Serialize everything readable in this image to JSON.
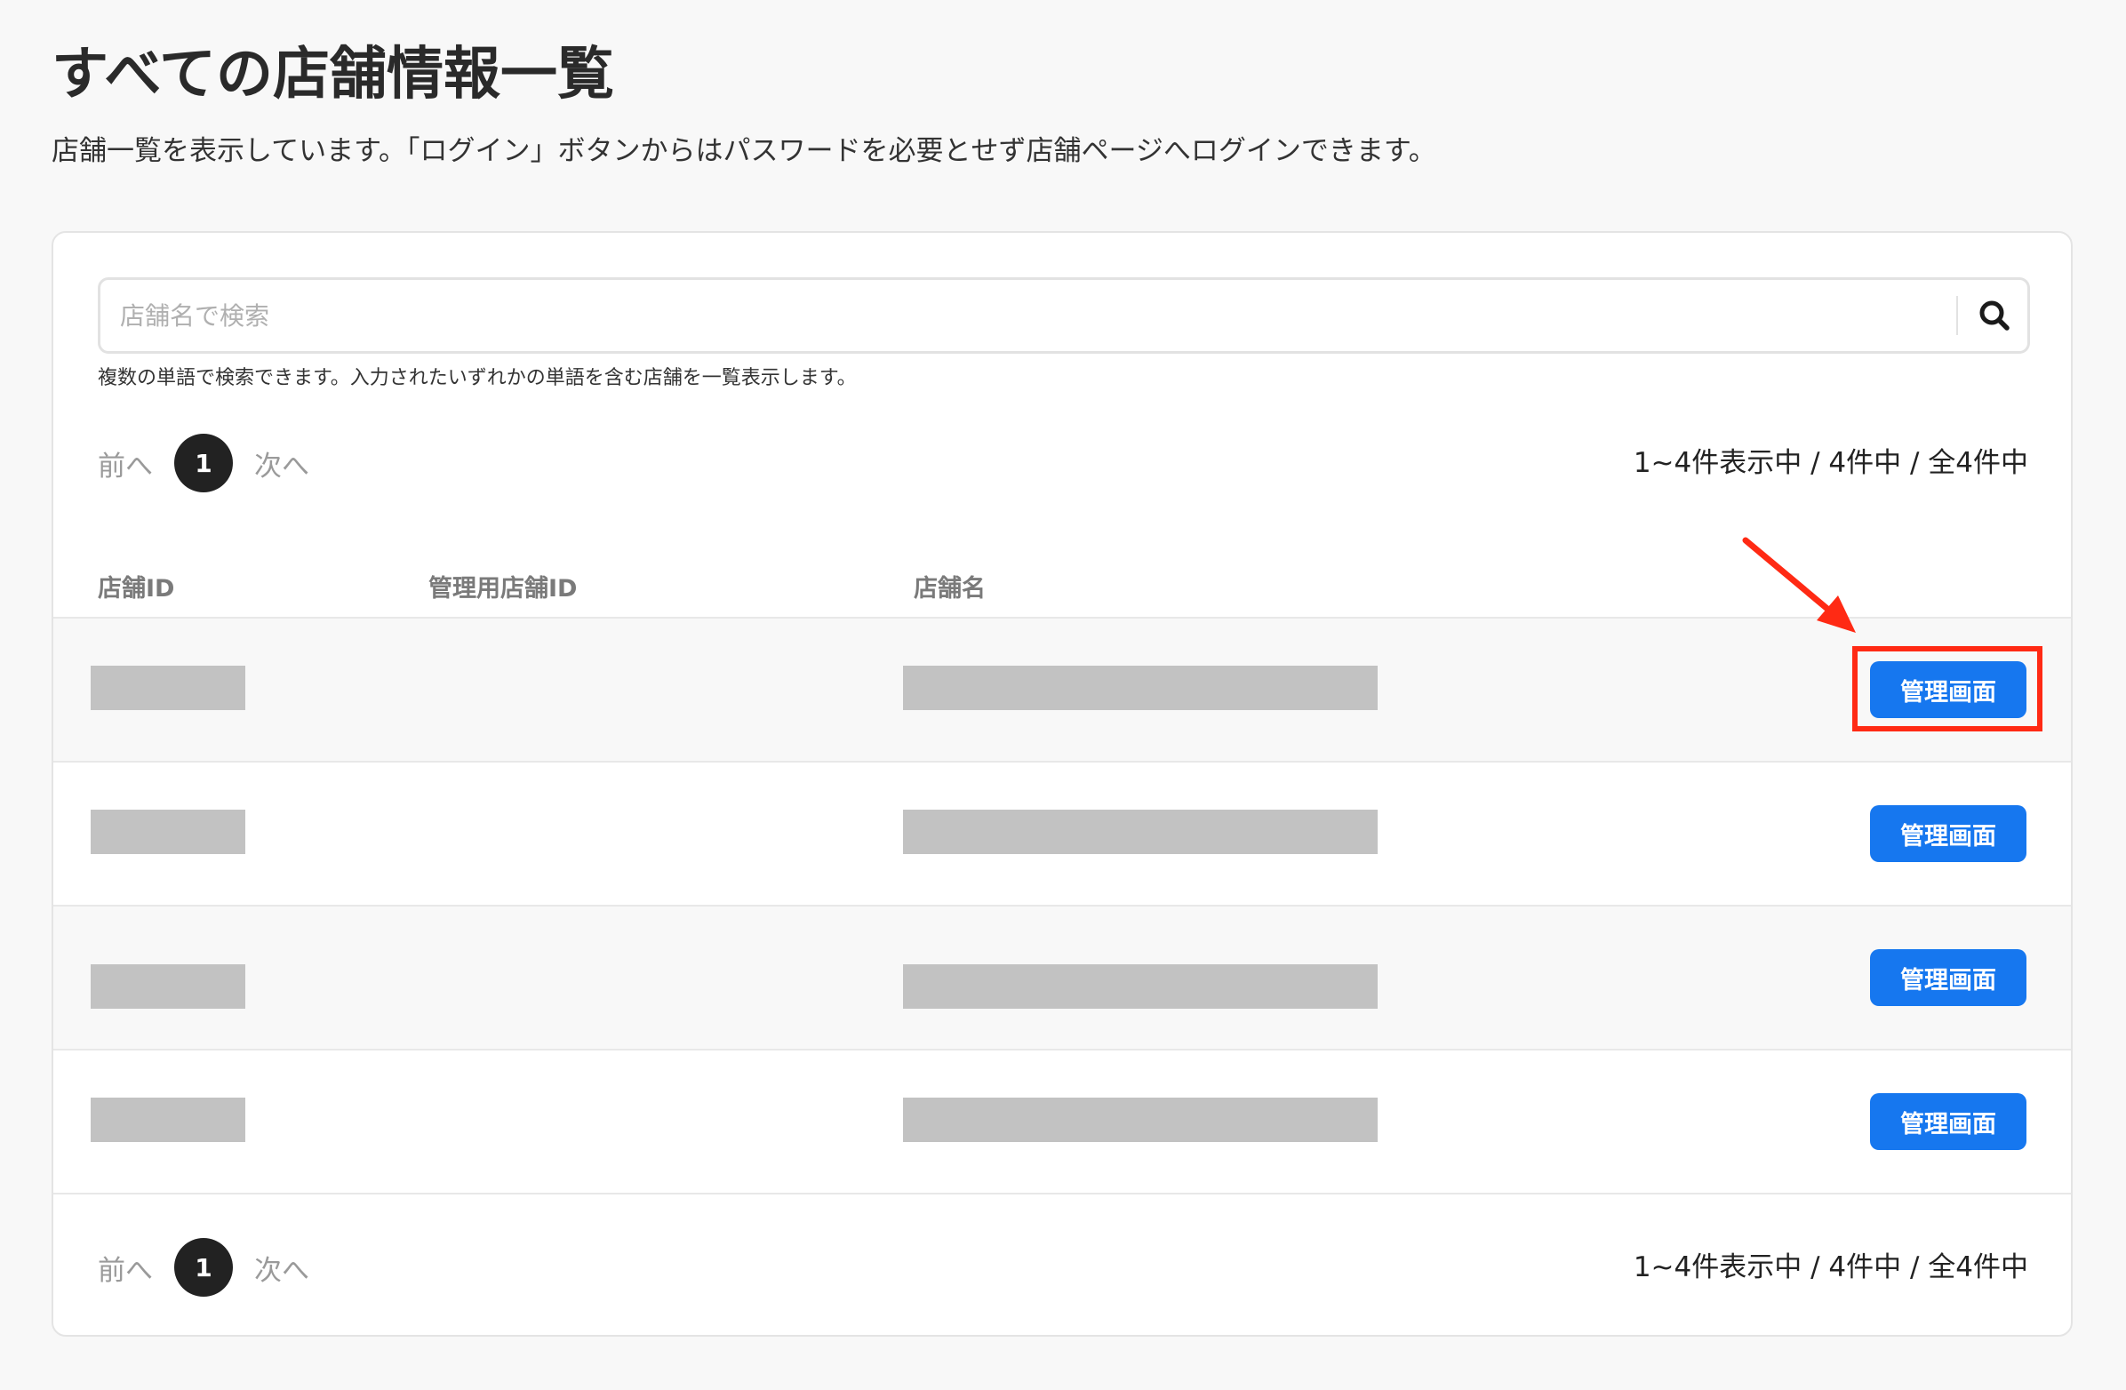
{
  "header": {
    "title": "すべての店舗情報一覧",
    "description": "店舗一覧を表示しています。「ログイン」ボタンからはパスワードを必要とせず店舗ページへログインできます。"
  },
  "search": {
    "placeholder": "店舗名で検索",
    "value": "",
    "hint": "複数の単語で検索できます。入力されたいずれかの単語を含む店舗を一覧表示します。",
    "icon": "search-icon"
  },
  "pagination": {
    "prev_label": "前へ",
    "next_label": "次へ",
    "current_page": "1",
    "result_count": "1~4件表示中 / 4件中 / 全4件中"
  },
  "table": {
    "columns": [
      "店舗ID",
      "管理用店舗ID",
      "店舗名"
    ],
    "rows": [
      {
        "admin_label": "管理画面"
      },
      {
        "admin_label": "管理画面"
      },
      {
        "admin_label": "管理画面"
      },
      {
        "admin_label": "管理画面"
      }
    ]
  },
  "annotation": {
    "color": "#ff2a14",
    "target": "first-row-admin-button"
  },
  "colors": {
    "primary": "#1677ef",
    "background": "#f8f8f8",
    "redacted": "#c2c2c2"
  }
}
